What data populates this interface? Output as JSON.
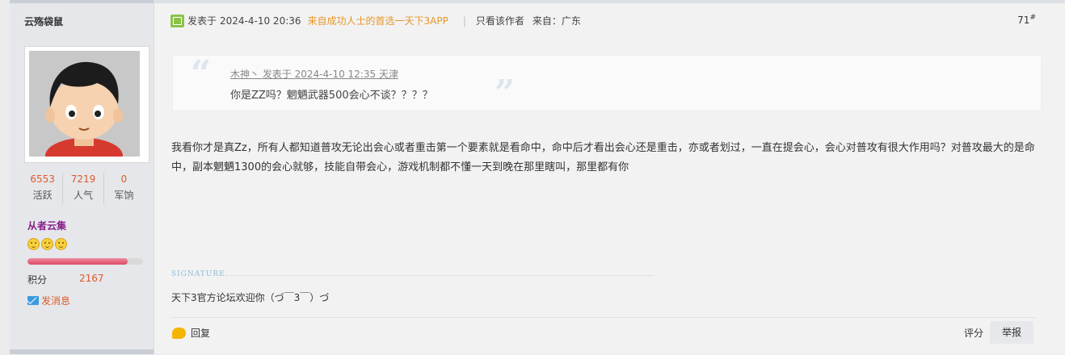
{
  "profile": {
    "author_name": "云殇袋鼠",
    "stats": [
      {
        "value": "6553",
        "label": "活跃"
      },
      {
        "value": "7219",
        "label": "人气"
      },
      {
        "value": "0",
        "label": "军饷"
      }
    ],
    "group": "从者云集",
    "level_progress": 0.87,
    "points_label": "积分",
    "points_value": "2167",
    "send_message": "发消息"
  },
  "post": {
    "posted_prefix": "发表于",
    "posted_time": "2024-4-10 20:36",
    "from_app": "来自成功人士的首选一天下3APP",
    "separator": "|",
    "only_author": "只看该作者",
    "from_label": "来自：广东",
    "floor_number": "71",
    "floor_symbol": "#",
    "quote": {
      "meta": "木神丶 发表于 2024-4-10 12:35 天津",
      "text": "你是ZZ吗？魍魉武器500会心不谈？？？？"
    },
    "content": "我看你才是真Zz，所有人都知道普攻无论出会心或者重击第一个要素就是看命中，命中后才看出会心还是重击，亦或者划过，一直在提会心，会心对普攻有很大作用吗？对普攻最大的是命中，副本魍魉1300的会心就够，技能自带会心，游戏机制都不懂一天到晚在那里瞎叫，那里都有你",
    "signature_label": "SIGNATURE",
    "signature_text": "天下3官方论坛欢迎你（づ￣3￣）づ",
    "reply_label": "回复",
    "rate_label": "评分",
    "report_label": "举报"
  },
  "colors": {
    "accent_orange": "#e05a2a",
    "group_purple": "#8a1f8a",
    "app_orange": "#e8962a"
  }
}
